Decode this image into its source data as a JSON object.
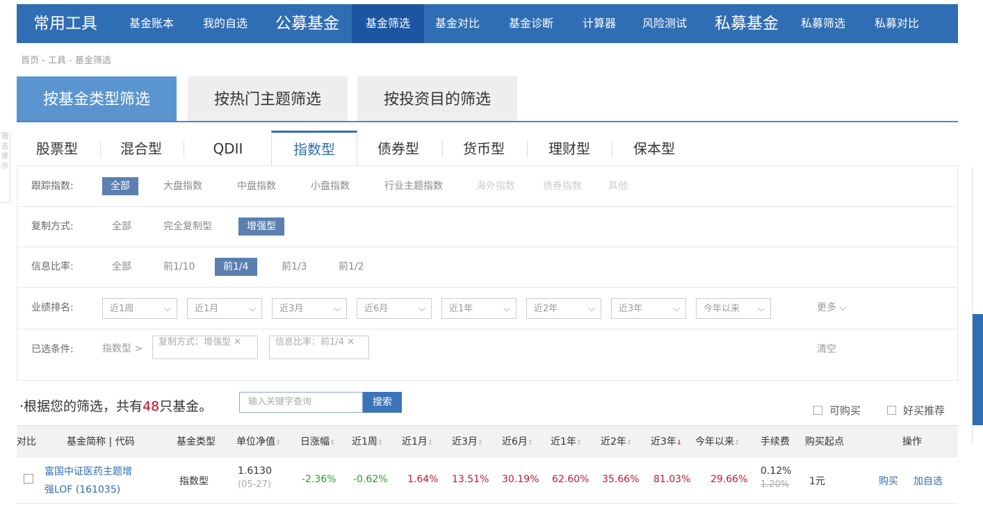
{
  "nav": [
    "常用工具",
    "基金账本",
    "我的自选",
    "公募基金",
    "基金筛选",
    "基金对比",
    "基金诊断",
    "计算器",
    "风险测试",
    "私募基金",
    "私募筛选",
    "私募对比"
  ],
  "breadcrumb": "首页 - 工具 - 基金筛选",
  "main_tabs": [
    "按基金类型筛选",
    "按热门主题筛选",
    "按投资目的筛选"
  ],
  "side_text": "筛选提示",
  "type_tabs": [
    "股票型",
    "混合型",
    "QDII",
    "指数型",
    "债券型",
    "货币型",
    "理财型",
    "保本型"
  ],
  "filters": {
    "track_label": "跟踪指数:",
    "track_opts": [
      "全部",
      "大盘指数",
      "中盘指数",
      "小盘指数",
      "行业主题指数",
      "海外指数",
      "债券指数",
      "其他"
    ],
    "copy_label": "复制方式:",
    "copy_opts": [
      "全部",
      "完全复制型",
      "增强型"
    ],
    "info_label": "信息比率:",
    "info_opts": [
      "全部",
      "前1/10",
      "前1/4",
      "前1/3",
      "前1/2"
    ],
    "rank_label": "业绩排名:",
    "rank_opts": [
      "近1周",
      "近1月",
      "近3月",
      "近6月",
      "近1年",
      "近2年",
      "近3年",
      "今年以来"
    ],
    "more": "更多",
    "selected_label": "已选条件:",
    "selected_type": "指数型 >",
    "selected_conds": [
      "复制方式：增强型",
      "信息比率：前1/4"
    ],
    "clear": "清空"
  },
  "summary": {
    "prefix": "根据您的筛选，共有",
    "count": "48",
    "suffix": "只基金。"
  },
  "search": {
    "placeholder": "输入关键字查询",
    "button": "搜索"
  },
  "checks": [
    "可购买",
    "好买推荐"
  ],
  "table": {
    "headers": [
      "对比",
      "基金简称 | 代码",
      "基金类型",
      "单位净值",
      "日涨幅",
      "近1周",
      "近1月",
      "近3月",
      "近6月",
      "近1年",
      "近2年",
      "近3年",
      "今年以来",
      "手续费",
      "购买起点",
      "操作"
    ],
    "rows": [
      {
        "name1": "富国中证医药主题增",
        "name2": "强LOF (161035)",
        "type": "指数型",
        "nav": "1.6130",
        "date": "(05-27)",
        "day": "-2.36%",
        "w1": "-0.62%",
        "m1": "1.64%",
        "m3": "13.51%",
        "m6": "30.19%",
        "y1": "62.60%",
        "y2": "35.66%",
        "y3": "81.03%",
        "ytd": "29.66%",
        "fee": "0.12%",
        "fee_orig": "1.20%",
        "min": "1元",
        "buy": "购买",
        "add": "加自选"
      }
    ]
  }
}
